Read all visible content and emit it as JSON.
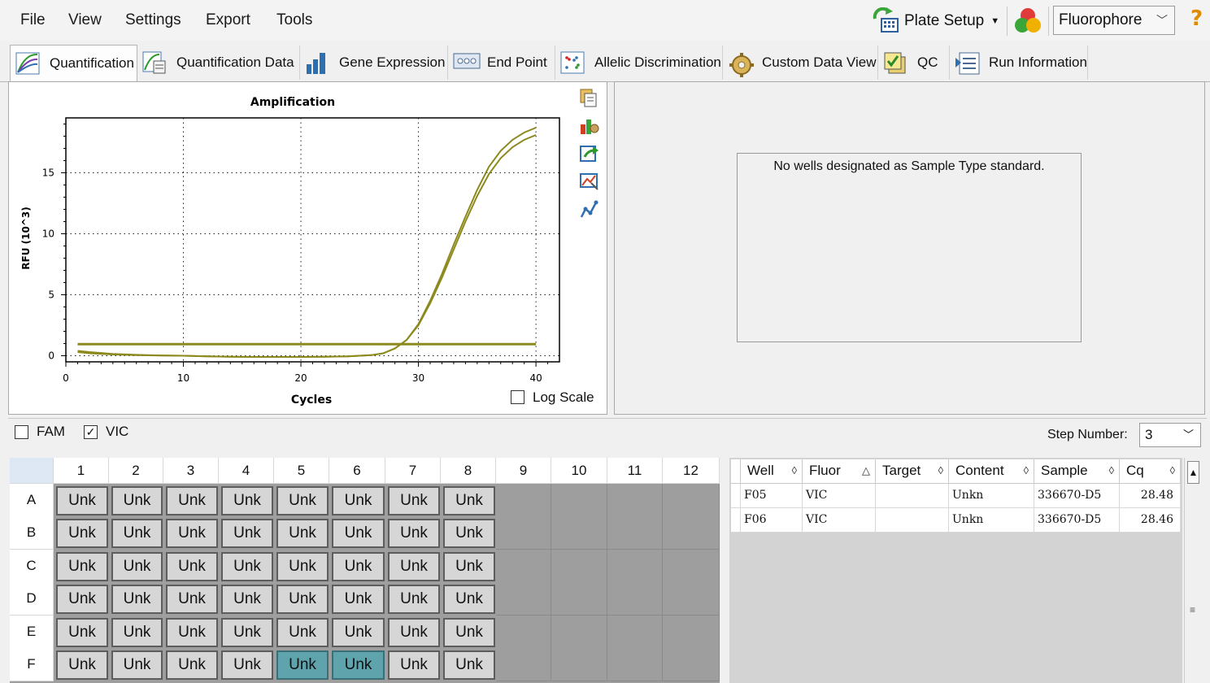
{
  "menu": {
    "file": "File",
    "view": "View",
    "settings": "Settings",
    "export": "Export",
    "tools": "Tools"
  },
  "toolbar": {
    "plate_setup": "Plate Setup",
    "fluor_select": "Fluorophore",
    "help": "?"
  },
  "tabs": [
    {
      "label": "Quantification",
      "icon": "quantification-icon",
      "active": true
    },
    {
      "label": "Quantification Data",
      "icon": "quantification-data-icon",
      "active": false
    },
    {
      "label": "Gene Expression",
      "icon": "gene-expression-icon",
      "active": false
    },
    {
      "label": "End Point",
      "icon": "end-point-icon",
      "active": false
    },
    {
      "label": "Allelic Discrimination",
      "icon": "allelic-discrimination-icon",
      "active": false
    },
    {
      "label": "Custom Data View",
      "icon": "custom-data-view-icon",
      "active": false
    },
    {
      "label": "QC",
      "icon": "qc-icon",
      "active": false
    },
    {
      "label": "Run Information",
      "icon": "run-information-icon",
      "active": false
    }
  ],
  "chart_data": {
    "type": "line",
    "title": "Amplification",
    "xlabel": "Cycles",
    "ylabel": "RFU (10^3)",
    "xlim": [
      0,
      42
    ],
    "ylim": [
      -0.5,
      19.5
    ],
    "xticks": [
      0,
      10,
      20,
      30,
      40
    ],
    "yticks": [
      0,
      5,
      10,
      15
    ],
    "grid": true,
    "color": "#8c8a1e",
    "threshold": 0.95,
    "series": [
      {
        "x": [
          1,
          2,
          4,
          6,
          8,
          10,
          12,
          14,
          16,
          18,
          20,
          22,
          24,
          26,
          27,
          28,
          29,
          30,
          31,
          32,
          33,
          34,
          35,
          36,
          37,
          38,
          39,
          40
        ],
        "y": [
          0.3,
          0.2,
          0.1,
          0.05,
          0.02,
          0.0,
          -0.05,
          -0.08,
          -0.1,
          -0.1,
          -0.1,
          -0.08,
          -0.05,
          0.05,
          0.2,
          0.6,
          1.3,
          2.5,
          4.3,
          6.4,
          8.7,
          11.0,
          13.1,
          14.9,
          16.2,
          17.1,
          17.7,
          18.1
        ]
      },
      {
        "x": [
          1,
          2,
          4,
          6,
          8,
          10,
          12,
          14,
          16,
          18,
          20,
          22,
          24,
          26,
          27,
          28,
          29,
          30,
          31,
          32,
          33,
          34,
          35,
          36,
          37,
          38,
          39,
          40
        ],
        "y": [
          0.4,
          0.3,
          0.15,
          0.07,
          0.03,
          0.0,
          -0.05,
          -0.08,
          -0.1,
          -0.1,
          -0.1,
          -0.08,
          -0.05,
          0.05,
          0.2,
          0.6,
          1.3,
          2.6,
          4.5,
          6.7,
          9.1,
          11.4,
          13.6,
          15.5,
          16.8,
          17.7,
          18.3,
          18.7
        ]
      }
    ]
  },
  "log_scale": {
    "label": "Log Scale",
    "checked": false
  },
  "std_message": "No wells designated as Sample Type standard.",
  "fluors": [
    {
      "label": "FAM",
      "checked": false
    },
    {
      "label": "VIC",
      "checked": true
    }
  ],
  "step": {
    "label": "Step Number:",
    "value": "3"
  },
  "plate": {
    "cols": [
      "1",
      "2",
      "3",
      "4",
      "5",
      "6",
      "7",
      "8",
      "9",
      "10",
      "11",
      "12"
    ],
    "rows": [
      "A",
      "B",
      "C",
      "D",
      "E",
      "F"
    ],
    "well_label": "Unk",
    "filled_cols": 8,
    "selected": [
      "F5",
      "F6"
    ]
  },
  "table": {
    "headers": [
      {
        "label": "Well",
        "sort": "◊"
      },
      {
        "label": "Fluor",
        "sort": "△"
      },
      {
        "label": "Target",
        "sort": "◊"
      },
      {
        "label": "Content",
        "sort": "◊"
      },
      {
        "label": "Sample",
        "sort": "◊"
      },
      {
        "label": "Cq",
        "sort": "◊"
      }
    ],
    "rows": [
      [
        "F05",
        "VIC",
        "",
        "Unkn",
        "336670-D5",
        "28.48"
      ],
      [
        "F06",
        "VIC",
        "",
        "Unkn",
        "336670-D5",
        "28.46"
      ]
    ]
  }
}
